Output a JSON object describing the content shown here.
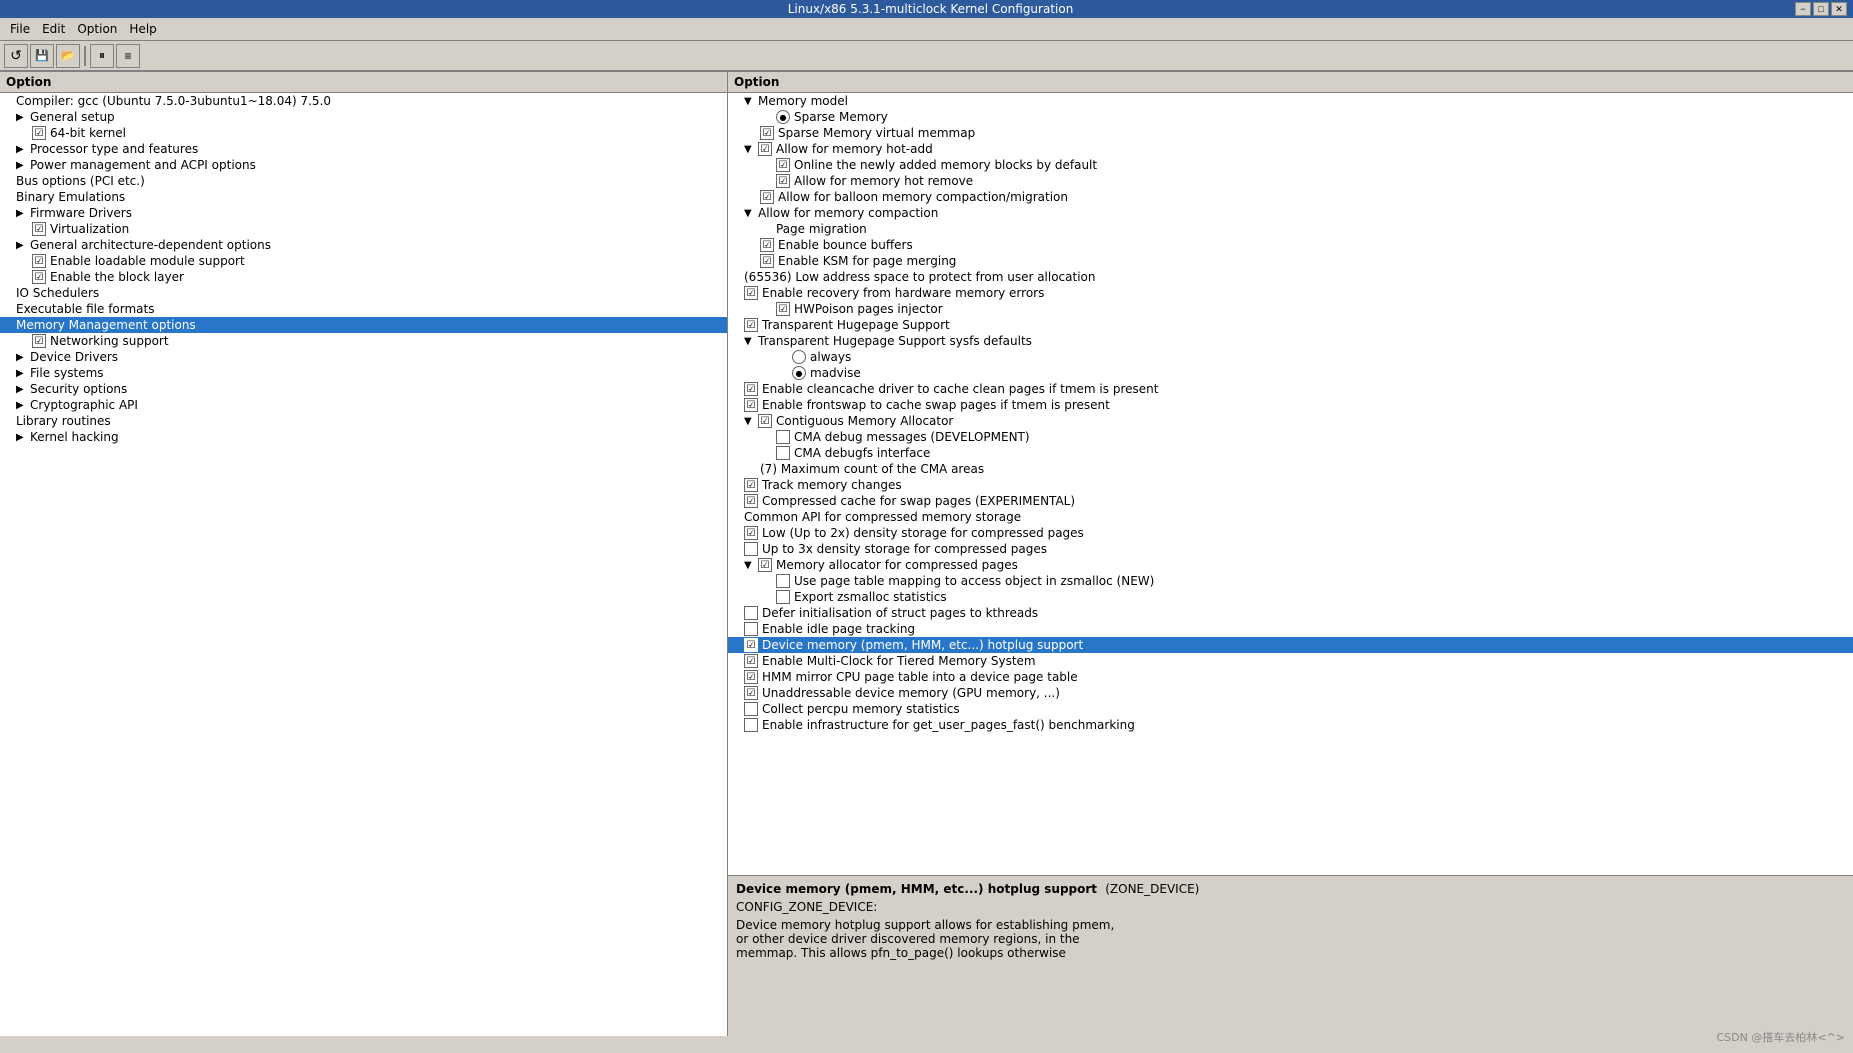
{
  "titleBar": {
    "title": "Linux/x86 5.3.1-multiclock Kernel Configuration",
    "minBtn": "−",
    "maxBtn": "□",
    "closeBtn": "✕"
  },
  "menuBar": {
    "items": [
      "File",
      "Edit",
      "Option",
      "Help"
    ]
  },
  "toolbar": {
    "buttons": [
      "↺",
      "💾",
      "📂",
      "|",
      "⏸",
      "≡"
    ]
  },
  "leftPane": {
    "header": "Option",
    "items": [
      {
        "id": "compiler",
        "label": "Compiler: gcc (Ubuntu 7.5.0-3ubuntu1~18.04) 7.5.0",
        "indent": "indent1",
        "type": "text",
        "depth": 0
      },
      {
        "id": "general-setup",
        "label": "General setup",
        "indent": "indent1",
        "type": "expand",
        "depth": 0
      },
      {
        "id": "64bit",
        "label": "64-bit kernel",
        "indent": "indent2",
        "type": "checkbox",
        "checked": true
      },
      {
        "id": "processor",
        "label": "Processor type and features",
        "indent": "indent1",
        "type": "expand",
        "depth": 0
      },
      {
        "id": "power",
        "label": "Power management and ACPI options",
        "indent": "indent1",
        "type": "expand",
        "depth": 0
      },
      {
        "id": "bus",
        "label": "Bus options (PCI etc.)",
        "indent": "indent1",
        "type": "text",
        "depth": 0
      },
      {
        "id": "binary",
        "label": "Binary Emulations",
        "indent": "indent1",
        "type": "text",
        "depth": 0
      },
      {
        "id": "firmware",
        "label": "Firmware Drivers",
        "indent": "indent1",
        "type": "expand",
        "depth": 0
      },
      {
        "id": "virtualization",
        "label": "Virtualization",
        "indent": "indent2",
        "type": "checkbox",
        "checked": true
      },
      {
        "id": "general-arch",
        "label": "General architecture-dependent options",
        "indent": "indent1",
        "type": "expand",
        "depth": 0
      },
      {
        "id": "loadable",
        "label": "Enable loadable module support",
        "indent": "indent2",
        "type": "checkbox",
        "checked": true
      },
      {
        "id": "block-layer",
        "label": "Enable the block layer",
        "indent": "indent2",
        "type": "checkbox",
        "checked": true
      },
      {
        "id": "io-sched",
        "label": "IO Schedulers",
        "indent": "indent1",
        "type": "text",
        "depth": 0
      },
      {
        "id": "exec-formats",
        "label": "Executable file formats",
        "indent": "indent1",
        "type": "text",
        "depth": 0
      },
      {
        "id": "memory-mgmt",
        "label": "Memory Management options",
        "indent": "indent1",
        "type": "text",
        "depth": 0,
        "selected": true
      },
      {
        "id": "networking",
        "label": "Networking support",
        "indent": "indent2",
        "type": "checkbox-expand",
        "checked": true
      },
      {
        "id": "device-drivers",
        "label": "Device Drivers",
        "indent": "indent1",
        "type": "expand",
        "depth": 0
      },
      {
        "id": "file-systems",
        "label": "File systems",
        "indent": "indent1",
        "type": "expand",
        "depth": 0
      },
      {
        "id": "security",
        "label": "Security options",
        "indent": "indent1",
        "type": "expand",
        "depth": 0
      },
      {
        "id": "crypto",
        "label": "Cryptographic API",
        "indent": "indent1",
        "type": "expand",
        "depth": 0
      },
      {
        "id": "library",
        "label": "Library routines",
        "indent": "indent1",
        "type": "text",
        "depth": 0
      },
      {
        "id": "kernel-hacking",
        "label": "Kernel hacking",
        "indent": "indent1",
        "type": "expand",
        "depth": 0
      }
    ]
  },
  "rightPane": {
    "header": "Option",
    "items": [
      {
        "id": "mem-model",
        "label": "Memory model",
        "indent": "indent1",
        "type": "expand-open",
        "depth": 0
      },
      {
        "id": "sparse-memory",
        "label": "Sparse Memory",
        "indent": "indent3",
        "type": "radio",
        "checked": true
      },
      {
        "id": "sparse-vmemmap",
        "label": "Sparse Memory virtual memmap",
        "indent": "indent2",
        "type": "checkbox",
        "checked": true
      },
      {
        "id": "allow-hotadd",
        "label": "Allow for memory hot-add",
        "indent": "indent1",
        "type": "checkbox-expand",
        "checked": true
      },
      {
        "id": "online-blocks",
        "label": "Online the newly added memory blocks by default",
        "indent": "indent3",
        "type": "checkbox",
        "checked": true
      },
      {
        "id": "allow-hotremove",
        "label": "Allow for memory hot remove",
        "indent": "indent3",
        "type": "checkbox",
        "checked": true
      },
      {
        "id": "balloon-compact",
        "label": "Allow for balloon memory compaction/migration",
        "indent": "indent2",
        "type": "checkbox",
        "checked": true
      },
      {
        "id": "mem-compact",
        "label": "Allow for memory compaction",
        "indent": "indent1",
        "type": "expand-open",
        "depth": 0
      },
      {
        "id": "page-migration",
        "label": "Page migration",
        "indent": "indent3",
        "type": "text"
      },
      {
        "id": "bounce-buffers",
        "label": "Enable bounce buffers",
        "indent": "indent2",
        "type": "checkbox",
        "checked": true
      },
      {
        "id": "ksm",
        "label": "Enable KSM for page merging",
        "indent": "indent2",
        "type": "checkbox",
        "checked": true
      },
      {
        "id": "lowaddr",
        "label": "(65536) Low address space to protect from user allocation",
        "indent": "indent1",
        "type": "text"
      },
      {
        "id": "hw-errors",
        "label": "Enable recovery from hardware memory errors",
        "indent": "indent1",
        "type": "checkbox",
        "checked": true
      },
      {
        "id": "hwpoison",
        "label": "HWPoison pages injector",
        "indent": "indent3",
        "type": "checkbox",
        "checked": true
      },
      {
        "id": "hugepage",
        "label": "Transparent Hugepage Support",
        "indent": "indent1",
        "type": "checkbox",
        "checked": true
      },
      {
        "id": "hugepage-sysfs",
        "label": "Transparent Hugepage Support sysfs defaults",
        "indent": "indent1",
        "type": "expand-open"
      },
      {
        "id": "always",
        "label": "always",
        "indent": "indent4",
        "type": "radio",
        "checked": false
      },
      {
        "id": "madvise",
        "label": "madvise",
        "indent": "indent4",
        "type": "radio",
        "checked": true
      },
      {
        "id": "cleancache",
        "label": "Enable cleancache driver to cache clean pages if tmem is present",
        "indent": "indent1",
        "type": "checkbox",
        "checked": true
      },
      {
        "id": "frontswap",
        "label": "Enable frontswap to cache swap pages if tmem is present",
        "indent": "indent1",
        "type": "checkbox",
        "checked": true
      },
      {
        "id": "cma",
        "label": "Contiguous Memory Allocator",
        "indent": "indent1",
        "type": "checkbox-expand",
        "checked": true
      },
      {
        "id": "cma-debug",
        "label": "CMA debug messages (DEVELOPMENT)",
        "indent": "indent3",
        "type": "checkbox",
        "checked": false
      },
      {
        "id": "cma-debugfs",
        "label": "CMA debugfs interface",
        "indent": "indent3",
        "type": "checkbox",
        "checked": false
      },
      {
        "id": "cma-max",
        "label": "(7) Maximum count of the CMA areas",
        "indent": "indent2",
        "type": "text"
      },
      {
        "id": "track-mem",
        "label": "Track memory changes",
        "indent": "indent1",
        "type": "checkbox",
        "checked": true
      },
      {
        "id": "compressed-swap",
        "label": "Compressed cache for swap pages (EXPERIMENTAL)",
        "indent": "indent1",
        "type": "checkbox",
        "checked": true
      },
      {
        "id": "common-api",
        "label": "Common API for compressed memory storage",
        "indent": "indent1",
        "type": "text"
      },
      {
        "id": "low-density",
        "label": "Low (Up to 2x) density storage for compressed pages",
        "indent": "indent1",
        "type": "checkbox",
        "checked": true
      },
      {
        "id": "up-to-3x",
        "label": "Up to 3x density storage for compressed pages",
        "indent": "indent1",
        "type": "checkbox",
        "checked": false
      },
      {
        "id": "mem-alloc-compressed",
        "label": "Memory allocator for compressed pages",
        "indent": "indent1",
        "type": "checkbox-expand",
        "checked": true
      },
      {
        "id": "page-table-map",
        "label": "Use page table mapping to access object in zsmalloc (NEW)",
        "indent": "indent3",
        "type": "checkbox",
        "checked": false
      },
      {
        "id": "export-zsmalloc",
        "label": "Export zsmalloc statistics",
        "indent": "indent3",
        "type": "checkbox",
        "checked": false
      },
      {
        "id": "defer-init",
        "label": "Defer initialisation of struct pages to kthreads",
        "indent": "indent1",
        "type": "checkbox",
        "checked": false
      },
      {
        "id": "idle-tracking",
        "label": "Enable idle page tracking",
        "indent": "indent1",
        "type": "checkbox",
        "checked": false
      },
      {
        "id": "device-memory",
        "label": "Device memory (pmem, HMM, etc...) hotplug support",
        "indent": "indent1",
        "type": "checkbox",
        "checked": true,
        "selected": true
      },
      {
        "id": "multi-clock",
        "label": "Enable Multi-Clock for Tiered Memory System",
        "indent": "indent1",
        "type": "checkbox",
        "checked": true
      },
      {
        "id": "hmm-mirror",
        "label": "HMM mirror CPU page table into a device page table",
        "indent": "indent1",
        "type": "checkbox",
        "checked": true
      },
      {
        "id": "unaddressable",
        "label": "Unaddressable device memory (GPU memory, ...)",
        "indent": "indent1",
        "type": "checkbox",
        "checked": true
      },
      {
        "id": "percpu-stats",
        "label": "Collect percpu memory statistics",
        "indent": "indent1",
        "type": "checkbox",
        "checked": false
      },
      {
        "id": "get-user-pages",
        "label": "Enable infrastructure for get_user_pages_fast() benchmarking",
        "indent": "indent1",
        "type": "checkbox",
        "checked": false
      }
    ],
    "description": {
      "title": "Device memory (pmem, HMM, etc...) hotplug support",
      "subtitle": "(ZONE_DEVICE)",
      "config": "CONFIG_ZONE_DEVICE:",
      "text": "Device memory hotplug support allows for establishing pmem,\nor other device driver discovered memory regions, in the\nmemmap. This allows pfn_to_page() lookups otherwise"
    }
  }
}
